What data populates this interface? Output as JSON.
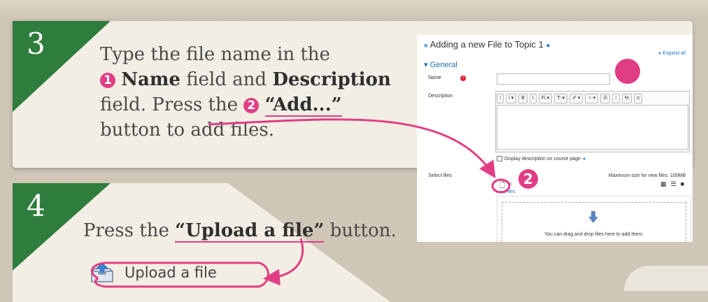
{
  "step3": {
    "number": "3",
    "line1": "Type the file name in the",
    "badge1": "1",
    "name_bold": "Name",
    "mid1": " field and ",
    "desc_bold": "Description",
    "line3a": "field. Press the ",
    "badge2": "2",
    "add_bold": "“Add...”",
    "line4": "button to add files."
  },
  "step4": {
    "number": "4",
    "press": "Press the ",
    "upload_bold": "“Upload a file”",
    "button_word": " button.",
    "upload_button_label": "Upload a file",
    "upload_icon": "upload-icon"
  },
  "moodle": {
    "title": "Adding a new File to Topic 1",
    "expand_all": "Expand all",
    "section": "General",
    "name_label": "Name",
    "description_label": "Description",
    "toolbar": [
      "⁝",
      "i ▾",
      "B",
      "I",
      "Fi ▾",
      "T: ▾",
      "✐ ▾",
      "♀ ▾",
      "☰",
      "⁝",
      "%",
      "⦸"
    ],
    "display_description": "Display description on course page",
    "select_files_label": "Select files",
    "max_size": "Maximum size for new files: 100MB",
    "files_label": "Files",
    "drop_text": "You can drag and drop files here to add them.",
    "marker_2": "2"
  },
  "colors": {
    "accent": "#e13d84",
    "flag_green": "#2f7d3c",
    "link_blue": "#1a6fb5",
    "card_bg": "#f2eee4"
  }
}
